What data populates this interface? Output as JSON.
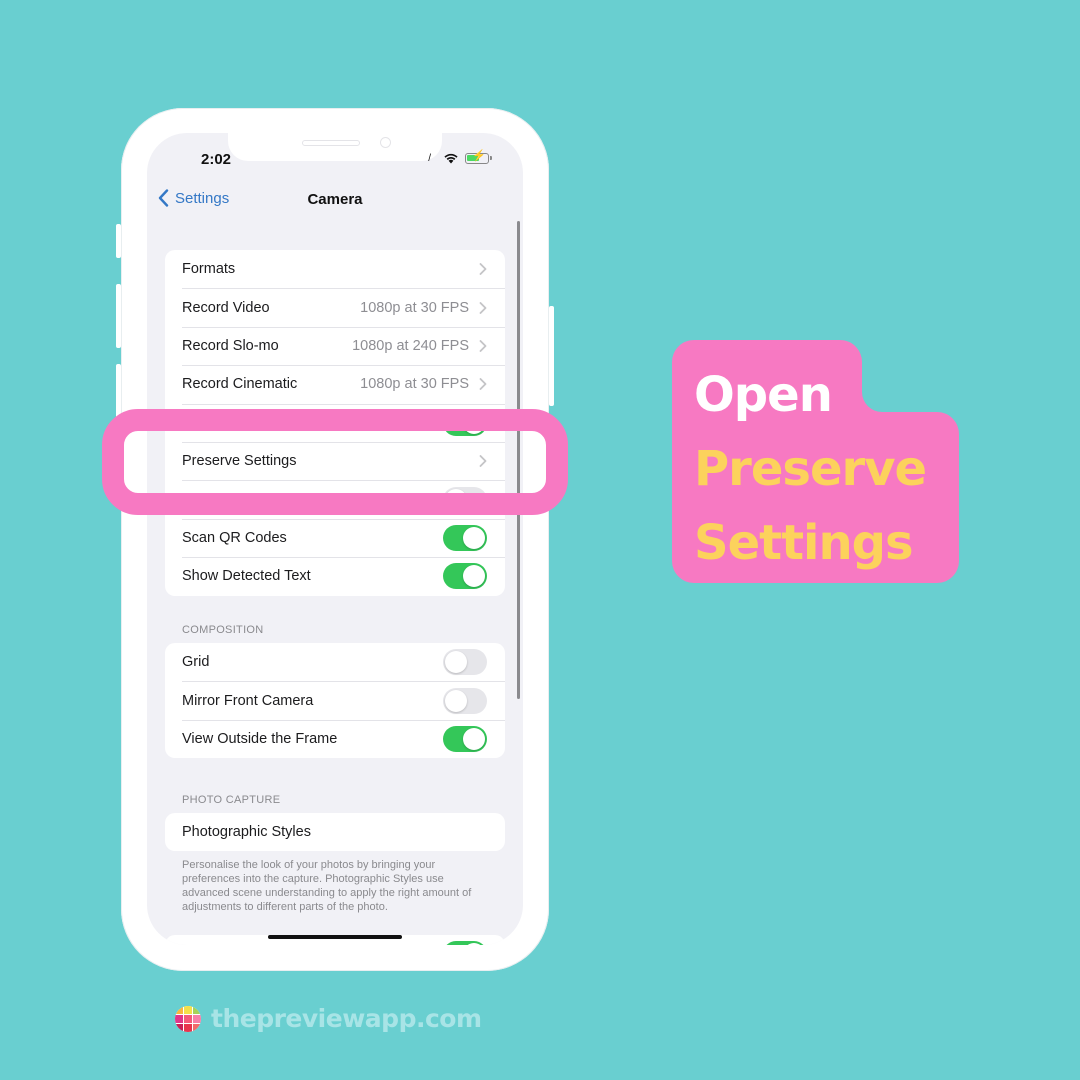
{
  "status_bar": {
    "time": "2:02"
  },
  "navbar": {
    "back_label": "Settings",
    "title": "Camera"
  },
  "group1": [
    {
      "label": "Formats",
      "value": "",
      "type": "chevron"
    },
    {
      "label": "Record Video",
      "value": "1080p at 30 FPS",
      "type": "chevron"
    },
    {
      "label": "Record Slo-mo",
      "value": "1080p at 240 FPS",
      "type": "chevron"
    },
    {
      "label": "Record Cinematic",
      "value": "1080p at 30 FPS",
      "type": "chevron"
    },
    {
      "label": "",
      "value": "",
      "type": "toggle",
      "on": true
    },
    {
      "label": "Preserve Settings",
      "value": "",
      "type": "chevron"
    },
    {
      "label": "",
      "value": "",
      "type": "toggle",
      "on": false
    },
    {
      "label": "Scan QR Codes",
      "value": "",
      "type": "toggle",
      "on": true
    },
    {
      "label": "Show Detected Text",
      "value": "",
      "type": "toggle",
      "on": true
    }
  ],
  "composition": {
    "header": "COMPOSITION",
    "rows": [
      {
        "label": "Grid",
        "on": false
      },
      {
        "label": "Mirror Front Camera",
        "on": false
      },
      {
        "label": "View Outside the Frame",
        "on": true
      }
    ]
  },
  "photo_capture": {
    "header": "PHOTO CAPTURE",
    "link_label": "Photographic Styles",
    "footnote": "Personalise the look of your photos by bringing your preferences into the capture. Photographic Styles use advanced scene understanding to apply the right amount of adjustments to different parts of the photo."
  },
  "callout": {
    "line1": "Open",
    "line2": "Preserve",
    "line3": "Settings"
  },
  "brand": {
    "text": "thepreviewapp.com"
  },
  "colors": {
    "background": "#69cfd0",
    "highlight": "#f779c2",
    "accent_yellow": "#fcd25c",
    "ios_blue": "#3478c6",
    "ios_green": "#34c759"
  }
}
